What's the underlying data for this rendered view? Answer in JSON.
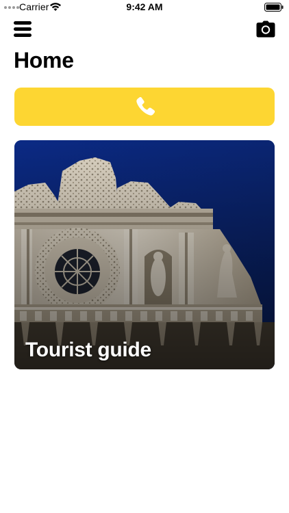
{
  "status_bar": {
    "carrier": "Carrier",
    "time": "9:42 AM"
  },
  "header": {
    "title": "Home",
    "menu_icon": "hamburger-menu-icon",
    "camera_icon": "camera-icon"
  },
  "call_button": {
    "icon": "phone-icon",
    "color": "#fdd632"
  },
  "card": {
    "label": "Tourist guide",
    "image": "baroque-church-facade-photo"
  }
}
